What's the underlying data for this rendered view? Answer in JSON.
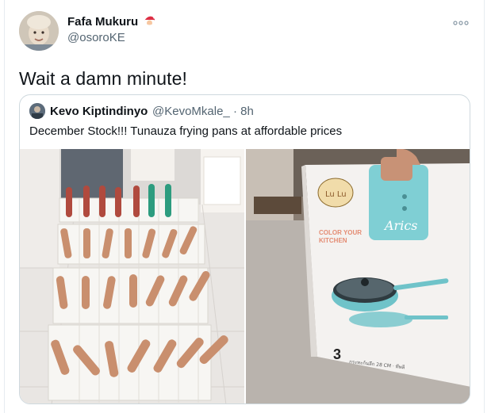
{
  "tweet": {
    "display_name": "Fafa Mukuru",
    "name_emoji": "santa-emoji",
    "handle": "@osoroKE",
    "text": "Wait a damn minute!",
    "more_icon": "more-horizontal-icon"
  },
  "quoted": {
    "display_name": "Kevo Kiptindinyo",
    "handle_time": "@KevoMkale_ · 8h",
    "text": "December Stock!!! Tunauza frying pans at affordable prices",
    "box": {
      "brand_text": "Lu Lu",
      "slogan": "COLOR YOUR KITCHEN",
      "product": "Arics",
      "number": "3",
      "fine_print": "กระทะก้นลึกพร้อมฝาแก้ว 28 CM · ทีพลี"
    }
  },
  "colors": {
    "text_primary": "#0f1419",
    "text_secondary": "#536471",
    "border": "#cfd9de",
    "accent_teal": "#6fc3c9"
  }
}
